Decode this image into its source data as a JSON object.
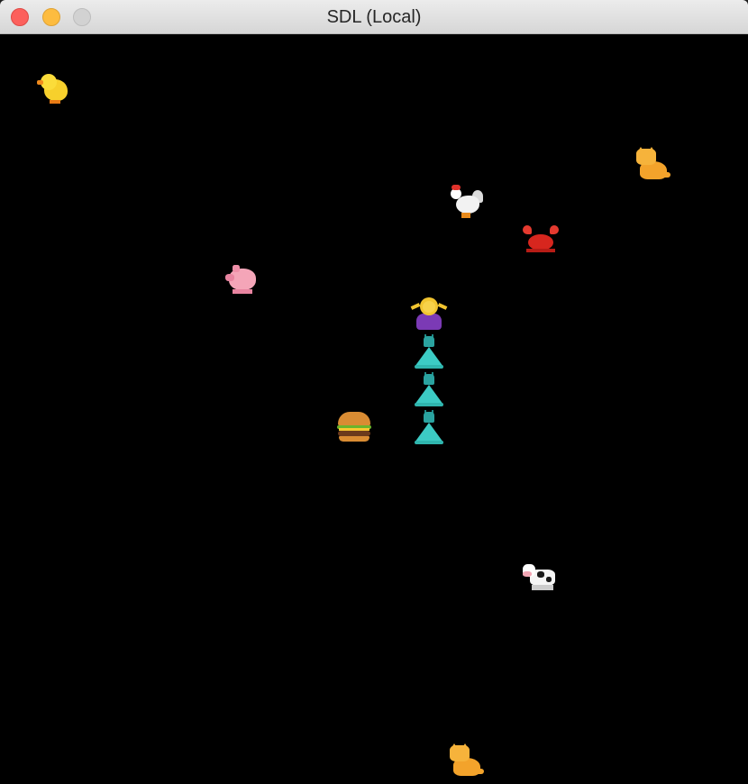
{
  "window": {
    "title": "SDL (Local)",
    "buttons": [
      "close",
      "minimize",
      "zoom"
    ]
  },
  "game": {
    "background": "#000000",
    "snake": {
      "head": "woman-gesturing-icon",
      "body_segments": [
        "dress-icon",
        "dress-icon",
        "dress-icon"
      ]
    },
    "food": "hamburger-icon",
    "obstacles": [
      "baby-chick-icon",
      "cat-icon",
      "rooster-icon",
      "crab-icon",
      "pig-icon",
      "cow-icon",
      "cat-icon"
    ]
  }
}
